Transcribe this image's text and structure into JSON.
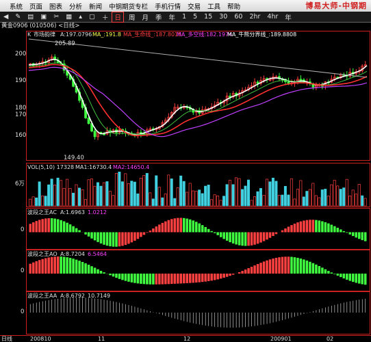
{
  "menu": {
    "items": [
      "系统",
      "页面",
      "图表",
      "分析",
      "新闻",
      "中钢期货专栏",
      "手机行情",
      "交易",
      "工具",
      "帮助"
    ],
    "brand": "博易大师-中钢期"
  },
  "toolbar": {
    "icons": [
      "back-icon",
      "draw-icon",
      "chart-icon",
      "window-icon",
      "cut-icon"
    ],
    "periods": [
      "日",
      "周",
      "月",
      "季",
      "年",
      "1",
      "5",
      "15",
      "30",
      "60",
      "2hr",
      "4hr",
      "年"
    ],
    "active_period": "日"
  },
  "title": "黄金0906 (010506) <日线>",
  "panels": {
    "main": {
      "label_prefix": "K",
      "indicator": "市场韵律",
      "legend": [
        {
          "text": "A:197.0796",
          "color": "#e0e0e0"
        },
        {
          "text": "MA_:191.8",
          "color": "#ffff55"
        },
        {
          "text": "MA_生命线_:187.8015",
          "color": "#ff4040"
        },
        {
          "text": "MA_多空线:182.1974",
          "color": "#ff40ff"
        },
        {
          "text": "MA_牛熊分界线_:189.8808",
          "color": "#ffffff"
        }
      ],
      "y_ticks": [
        "200",
        "190",
        "180",
        "170",
        "160"
      ],
      "annotations": {
        "high": "205.89",
        "low": "149.40"
      }
    },
    "vol": {
      "legend": [
        {
          "text": "VOL(5,10) 17328",
          "color": "#e0e0e0"
        },
        {
          "text": "MA1:16730.4",
          "color": "#e0e0e0"
        },
        {
          "text": "MA2:14650.4",
          "color": "#ff40ff"
        }
      ],
      "y_tick": "6万"
    },
    "ac": {
      "legend": [
        {
          "text": "波段之王AC",
          "color": "#e0e0e0"
        },
        {
          "text": "A:1.6963",
          "color": "#e0e0e0"
        },
        {
          "text": "1.0212",
          "color": "#ff40ff"
        }
      ],
      "y_tick": "0"
    },
    "ao": {
      "legend": [
        {
          "text": "波段之王AO",
          "color": "#e0e0e0"
        },
        {
          "text": "A:8.7204",
          "color": "#e0e0e0"
        },
        {
          "text": "6.5464",
          "color": "#ff40ff"
        }
      ],
      "y_tick": "0"
    },
    "aa": {
      "legend": [
        {
          "text": "波段之王AA",
          "color": "#e0e0e0"
        },
        {
          "text": "A:8.6792",
          "color": "#e0e0e0"
        },
        {
          "text": "10.7149",
          "color": "#e0e0e0"
        }
      ],
      "y_tick": "0"
    }
  },
  "x_axis": {
    "period_label": "日线",
    "labels": [
      "200810",
      "11",
      "12",
      "200901",
      "02"
    ]
  },
  "colors": {
    "up": "#ff4040",
    "down": "#40ff40",
    "vol_down": "#40d0e0",
    "axis": "#cc2020",
    "text": "#e0e0e0"
  }
}
